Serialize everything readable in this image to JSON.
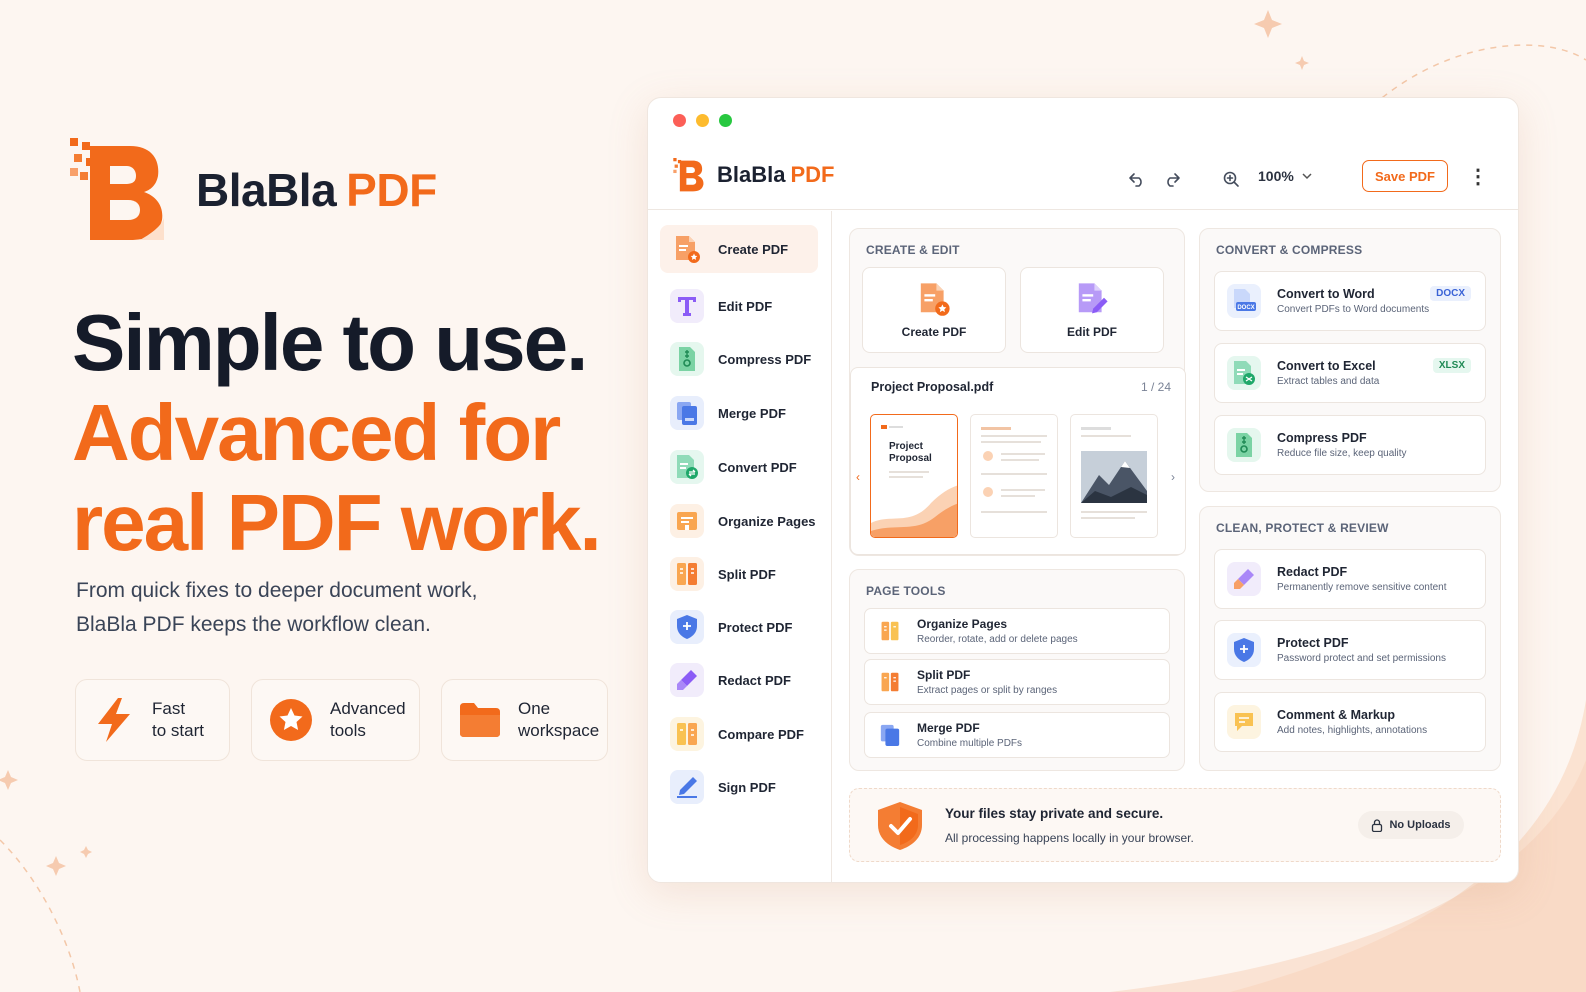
{
  "brand": {
    "name_main": "BlaBla",
    "name_accent": "PDF"
  },
  "hero": {
    "line1": "Simple to use.",
    "line2": "Advanced for",
    "line3": "real PDF work.",
    "sub1": "From quick fixes to deeper document work,",
    "sub2": "BlaBla PDF keeps the workflow clean."
  },
  "features": [
    {
      "l1": "Fast",
      "l2": "to start",
      "icon": "lightning-icon"
    },
    {
      "l1": "Advanced",
      "l2": "tools",
      "icon": "star-icon"
    },
    {
      "l1": "One",
      "l2": "workspace",
      "icon": "folder-icon"
    }
  ],
  "colors": {
    "accent": "#f26a1b",
    "dark": "#151b29",
    "bg": "#fdf6f1"
  },
  "app": {
    "name_main": "BlaBla",
    "name_accent": "PDF",
    "zoom": "100%",
    "save_label": "Save PDF",
    "sidebar": [
      {
        "label": "Create PDF",
        "icon": "create-pdf-icon"
      },
      {
        "label": "Edit PDF",
        "icon": "edit-text-icon"
      },
      {
        "label": "Compress PDF",
        "icon": "compress-icon"
      },
      {
        "label": "Merge PDF",
        "icon": "merge-icon"
      },
      {
        "label": "Convert PDF",
        "icon": "convert-icon"
      },
      {
        "label": "Organize Pages",
        "icon": "organize-icon"
      },
      {
        "label": "Split PDF",
        "icon": "split-icon"
      },
      {
        "label": "Protect PDF",
        "icon": "shield-icon"
      },
      {
        "label": "Redact PDF",
        "icon": "redact-icon"
      },
      {
        "label": "Compare PDF",
        "icon": "compare-icon"
      },
      {
        "label": "Sign PDF",
        "icon": "sign-icon"
      }
    ],
    "create_edit": {
      "title": "CREATE & EDIT",
      "create_label": "Create PDF",
      "edit_label": "Edit PDF",
      "doc_name": "Project Proposal.pdf",
      "page_indicator": "1  /  24",
      "thumb_title1": "Project",
      "thumb_title2": "Proposal"
    },
    "page_tools": {
      "title": "PAGE TOOLS",
      "items": [
        {
          "title": "Organize Pages",
          "desc": "Reorder, rotate, add or delete pages"
        },
        {
          "title": "Split PDF",
          "desc": "Extract pages or split by ranges"
        },
        {
          "title": "Merge PDF",
          "desc": "Combine multiple PDFs"
        }
      ]
    },
    "convert": {
      "title": "CONVERT & COMPRESS",
      "items": [
        {
          "title": "Convert to Word",
          "desc": "Convert PDFs to Word documents",
          "badge": "DOCX"
        },
        {
          "title": "Convert to Excel",
          "desc": "Extract tables and data",
          "badge": "XLSX"
        },
        {
          "title": "Compress PDF",
          "desc": "Reduce file size, keep quality",
          "badge": ""
        }
      ]
    },
    "clean": {
      "title": "CLEAN, PROTECT & REVIEW",
      "items": [
        {
          "title": "Redact PDF",
          "desc": "Permanently remove sensitive content"
        },
        {
          "title": "Protect PDF",
          "desc": "Password protect and set permissions"
        },
        {
          "title": "Comment & Markup",
          "desc": "Add notes, highlights, annotations"
        }
      ]
    },
    "secure": {
      "title": "Your files stay private and secure.",
      "desc": "All processing happens locally in your browser.",
      "badge": "No Uploads"
    }
  }
}
